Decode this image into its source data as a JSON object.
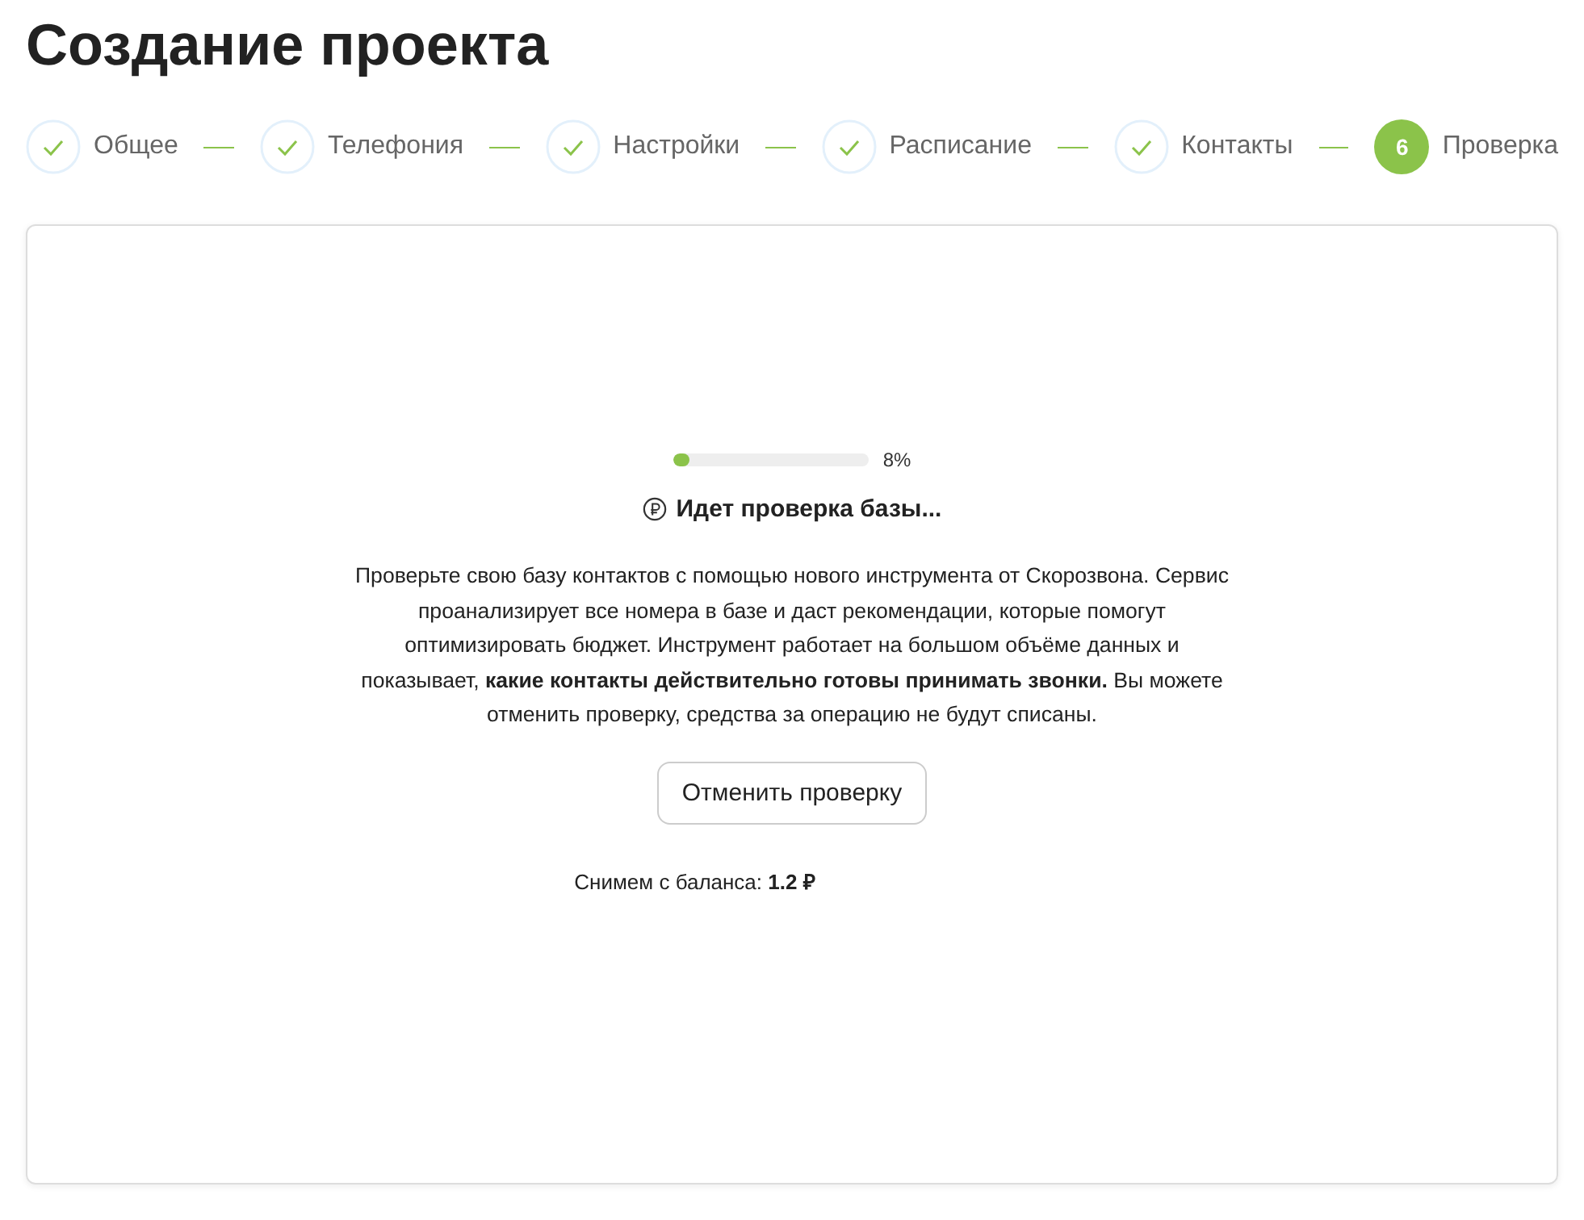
{
  "page_title": "Создание проекта",
  "steps": [
    {
      "label": "Общее",
      "completed": true
    },
    {
      "label": "Телефония",
      "completed": true
    },
    {
      "label": "Настройки",
      "completed": true
    },
    {
      "label": "Расписание",
      "completed": true
    },
    {
      "label": "Контакты",
      "completed": true
    },
    {
      "label": "Проверка",
      "completed": false,
      "number": "6"
    }
  ],
  "check": {
    "level": 0.08,
    "percent": "8%",
    "status": "Идет проверка базы...",
    "description": "Проверьте свою базу контактов с помощью нового инструмента от Скорозвона. Сервис проанализирует все номера в базе и даст рекомендации, которые помогут оптимизировать бюджет. Инструмент работает на большом объёме данных и показывает, **какие контакты действительно готовы принимать звонки.** Вы можете отменить проверку, средства за операцию не будут списаны.",
    "cancel_button": "Отменить проверку",
    "balance": "Снимем с баланса: **1.2 ₽**"
  }
}
